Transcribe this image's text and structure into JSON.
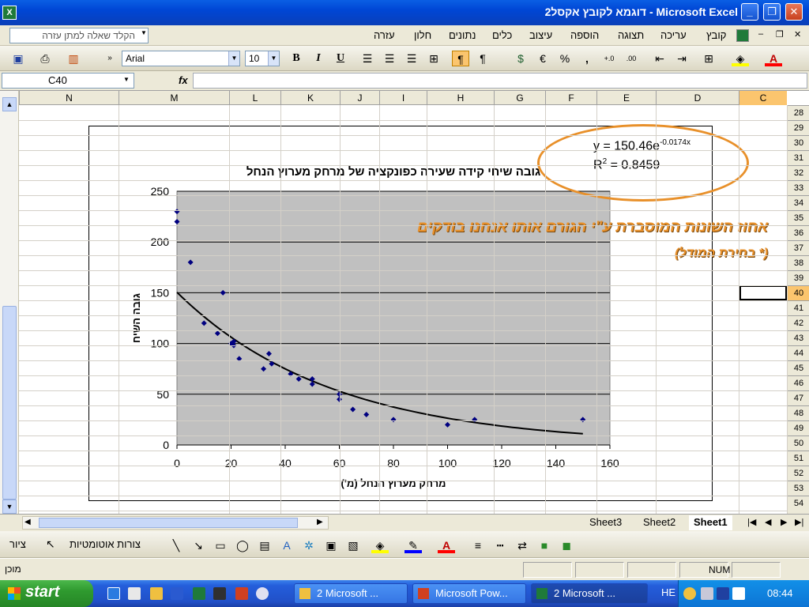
{
  "window": {
    "title": "Microsoft Excel - דוגמא לקובץ אקסל2",
    "app_icon": "X"
  },
  "menu": {
    "items": [
      "קובץ",
      "עריכה",
      "תצוגה",
      "הוספה",
      "עיצוב",
      "כלים",
      "נתונים",
      "חלון",
      "עזרה"
    ],
    "ask_placeholder": "הקלד שאלה למתן עזרה"
  },
  "toolbar": {
    "font_name": "Arial",
    "font_size": "10",
    "bold": "B",
    "italic": "I",
    "underline": "U",
    "percent": "%",
    "comma": ",",
    "euro": "€",
    "inc_decimal": "+.0",
    "dec_decimal": ".00"
  },
  "formula_bar": {
    "name_box": "C40",
    "fx_label": "fx",
    "value": ""
  },
  "columns": [
    {
      "label": "N"
    },
    {
      "label": "M"
    },
    {
      "label": "L"
    },
    {
      "label": "K"
    },
    {
      "label": "J"
    },
    {
      "label": "I"
    },
    {
      "label": "H"
    },
    {
      "label": "G"
    },
    {
      "label": "F"
    },
    {
      "label": "E"
    },
    {
      "label": "D"
    },
    {
      "label": "C",
      "selected": true
    }
  ],
  "rows": [
    "28",
    "29",
    "30",
    "31",
    "32",
    "33",
    "34",
    "35",
    "36",
    "37",
    "38",
    "39",
    "40",
    "41",
    "42",
    "43",
    "44",
    "45",
    "46",
    "47",
    "48",
    "49",
    "50",
    "51",
    "52",
    "53",
    "54"
  ],
  "selected_row": "40",
  "annotation": {
    "equation_y": "y = 150.46e",
    "equation_exp": "-0.0174x",
    "r_squared_r": "R",
    "r_squared_sup": "2",
    "r_squared_val": " = 0.8459",
    "explained_variance": "אחוז השונות המוסברת ע\"י הגורם אותו אנחנו בודקים",
    "model_choice": "(* בחירת המודל)",
    "highlight_color": "#e8902a"
  },
  "chart_data": {
    "type": "scatter",
    "title": "גובה שיחי קידה שעירה כפונקציה של מרחק מערוץ הנחל",
    "xlabel": "מרחק מערוץ הנחל (מ')",
    "ylabel": "גובה השיח",
    "xlim": [
      0,
      160
    ],
    "ylim": [
      0,
      250
    ],
    "xticks": [
      0,
      20,
      40,
      60,
      80,
      100,
      120,
      140,
      160
    ],
    "yticks": [
      0,
      50,
      100,
      150,
      200,
      250
    ],
    "plot_bg": "#c0c0c0",
    "marker_color": "#000080",
    "grid": "horizontal",
    "points": [
      [
        0,
        230
      ],
      [
        0,
        220
      ],
      [
        5,
        180
      ],
      [
        10,
        120
      ],
      [
        15,
        110
      ],
      [
        17,
        150
      ],
      [
        20,
        100
      ],
      [
        21,
        98
      ],
      [
        21,
        102
      ],
      [
        23,
        85
      ],
      [
        32,
        75
      ],
      [
        34,
        90
      ],
      [
        35,
        80
      ],
      [
        42,
        70
      ],
      [
        45,
        65
      ],
      [
        50,
        60
      ],
      [
        50,
        65
      ],
      [
        60,
        45
      ],
      [
        60,
        50
      ],
      [
        65,
        35
      ],
      [
        70,
        30
      ],
      [
        80,
        25
      ],
      [
        100,
        20
      ],
      [
        110,
        25
      ],
      [
        150,
        25
      ]
    ],
    "trendline": {
      "type": "exponential",
      "a": 150.46,
      "b": -0.0174,
      "x_range": [
        0,
        150
      ]
    }
  },
  "sheet_tabs": [
    {
      "label": "Sheet3"
    },
    {
      "label": "Sheet2"
    },
    {
      "label": "Sheet1",
      "active": true
    }
  ],
  "drawing_toolbar": {
    "draw_label": "ציור",
    "autoshapes_label": "צורות אוטומטיות"
  },
  "status": {
    "ready": "מוכן",
    "num": "NUM"
  },
  "taskbar": {
    "start_label": "start",
    "tasks": [
      {
        "label": "2 Microsoft ...",
        "active": false
      },
      {
        "label": "Microsoft Pow...",
        "active": false
      },
      {
        "label": "2 Microsoft ...",
        "active": true
      }
    ],
    "lang": "HE",
    "clock": "08:44"
  }
}
